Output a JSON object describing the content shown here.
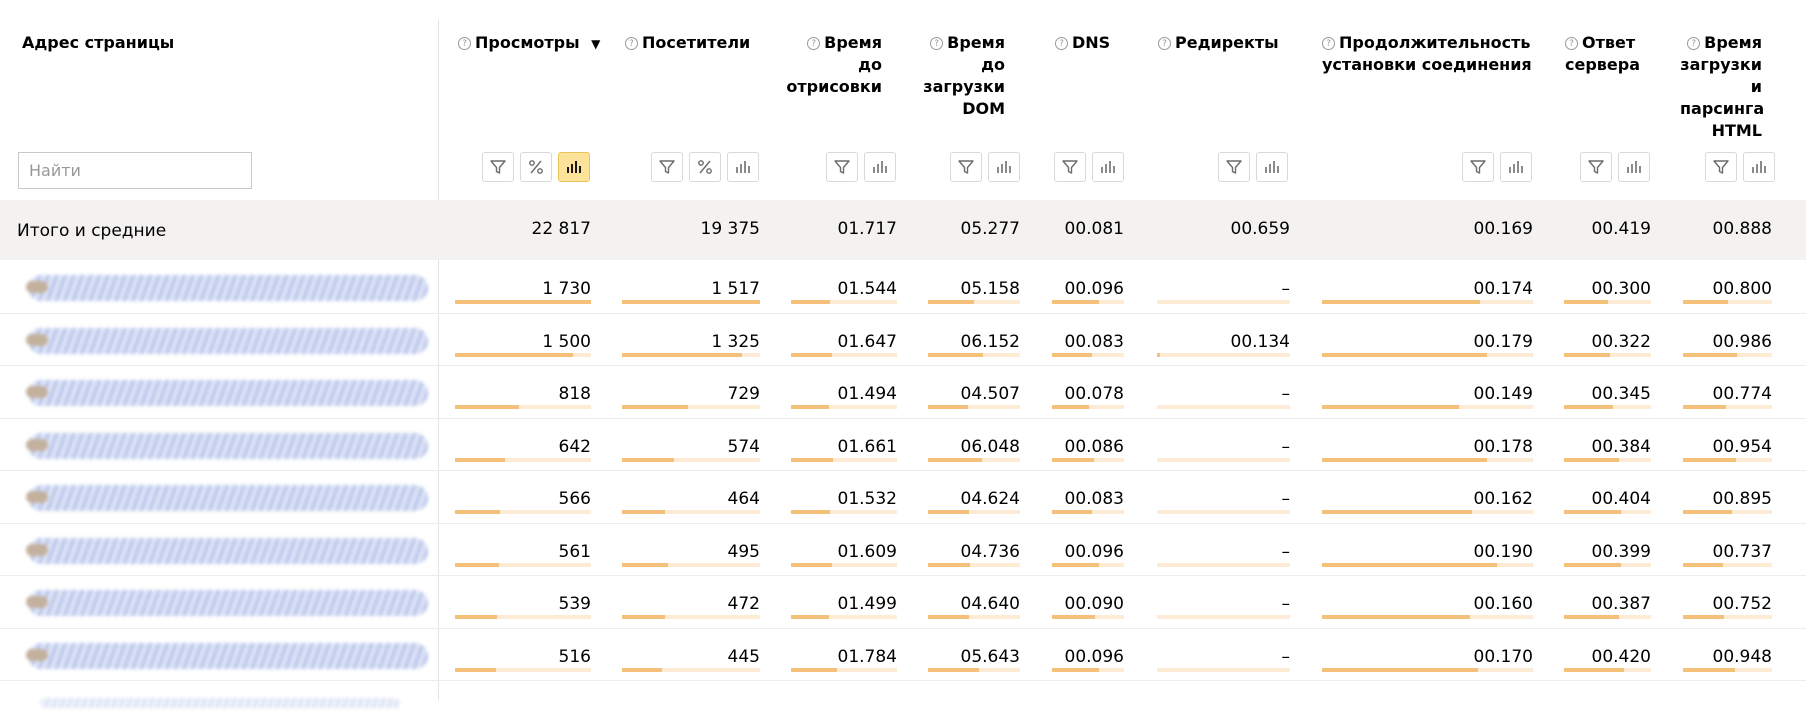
{
  "search": {
    "placeholder": "Найти"
  },
  "headers": {
    "url": "Адрес страницы",
    "views": "Просмотры",
    "sort_arrow": "▼",
    "visitors": "Посетители",
    "render": [
      "Время",
      "до",
      "отрисовки"
    ],
    "dom": [
      "Время",
      "до",
      "загрузки",
      "DOM"
    ],
    "dns": "DNS",
    "redirects": "Редиректы",
    "connect": [
      "Продолжительность",
      "установки соединения"
    ],
    "server": [
      "Ответ",
      "сервера"
    ],
    "html": [
      "Время",
      "загрузки",
      "и",
      "парсинга",
      "HTML"
    ],
    "help_glyph": "?",
    "percent_glyph": "%"
  },
  "totals": {
    "label": "Итого и средние",
    "views": "22 817",
    "visitors": "19 375",
    "render": "01.717",
    "dom": "05.277",
    "dns": "00.081",
    "redirects": "00.659",
    "connect": "00.169",
    "server": "00.419",
    "html": "00.888"
  },
  "rows": [
    {
      "views": "1 730",
      "visitors": "1 517",
      "render": "01.544",
      "dom": "05.158",
      "dns": "00.096",
      "redirects": "–",
      "connect": "00.174",
      "server": "00.300",
      "html": "00.800"
    },
    {
      "views": "1 500",
      "visitors": "1 325",
      "render": "01.647",
      "dom": "06.152",
      "dns": "00.083",
      "redirects": "00.134",
      "connect": "00.179",
      "server": "00.322",
      "html": "00.986"
    },
    {
      "views": "818",
      "visitors": "729",
      "render": "01.494",
      "dom": "04.507",
      "dns": "00.078",
      "redirects": "–",
      "connect": "00.149",
      "server": "00.345",
      "html": "00.774"
    },
    {
      "views": "642",
      "visitors": "574",
      "render": "01.661",
      "dom": "06.048",
      "dns": "00.086",
      "redirects": "–",
      "connect": "00.178",
      "server": "00.384",
      "html": "00.954"
    },
    {
      "views": "566",
      "visitors": "464",
      "render": "01.532",
      "dom": "04.624",
      "dns": "00.083",
      "redirects": "–",
      "connect": "00.162",
      "server": "00.404",
      "html": "00.895"
    },
    {
      "views": "561",
      "visitors": "495",
      "render": "01.609",
      "dom": "04.736",
      "dns": "00.096",
      "redirects": "–",
      "connect": "00.190",
      "server": "00.399",
      "html": "00.737"
    },
    {
      "views": "539",
      "visitors": "472",
      "render": "01.499",
      "dom": "04.640",
      "dns": "00.090",
      "redirects": "–",
      "connect": "00.160",
      "server": "00.387",
      "html": "00.752"
    },
    {
      "views": "516",
      "visitors": "445",
      "render": "01.784",
      "dom": "05.643",
      "dns": "00.096",
      "redirects": "–",
      "connect": "00.170",
      "server": "00.420",
      "html": "00.948"
    }
  ],
  "bar_fractions": [
    {
      "views": 1.0,
      "visitors": 1.0,
      "render": 0.37,
      "dom": 0.5,
      "dns": 0.65,
      "redirects": 0.0,
      "connect": 0.75,
      "server": 0.5,
      "html": 0.5
    },
    {
      "views": 0.87,
      "visitors": 0.87,
      "render": 0.39,
      "dom": 0.6,
      "dns": 0.56,
      "redirects": 0.02,
      "connect": 0.78,
      "server": 0.53,
      "html": 0.61
    },
    {
      "views": 0.47,
      "visitors": 0.48,
      "render": 0.36,
      "dom": 0.44,
      "dns": 0.52,
      "redirects": 0.0,
      "connect": 0.65,
      "server": 0.56,
      "html": 0.48
    },
    {
      "views": 0.37,
      "visitors": 0.38,
      "render": 0.4,
      "dom": 0.59,
      "dns": 0.58,
      "redirects": 0.0,
      "connect": 0.78,
      "server": 0.63,
      "html": 0.59
    },
    {
      "views": 0.33,
      "visitors": 0.31,
      "render": 0.37,
      "dom": 0.45,
      "dns": 0.56,
      "redirects": 0.0,
      "connect": 0.71,
      "server": 0.66,
      "html": 0.55
    },
    {
      "views": 0.32,
      "visitors": 0.33,
      "render": 0.39,
      "dom": 0.46,
      "dns": 0.65,
      "redirects": 0.0,
      "connect": 0.83,
      "server": 0.65,
      "html": 0.45
    },
    {
      "views": 0.31,
      "visitors": 0.31,
      "render": 0.36,
      "dom": 0.45,
      "dns": 0.6,
      "redirects": 0.0,
      "connect": 0.7,
      "server": 0.63,
      "html": 0.46
    },
    {
      "views": 0.3,
      "visitors": 0.29,
      "render": 0.43,
      "dom": 0.55,
      "dns": 0.65,
      "redirects": 0.0,
      "connect": 0.74,
      "server": 0.69,
      "html": 0.58
    }
  ],
  "colors": {
    "bar": "#f5c07a",
    "bar_track": "#fdebd5",
    "active_button": "#fde399",
    "total_row": "#f3f2f1"
  },
  "icons": {
    "filter": "filter-icon",
    "percent": "percent-icon",
    "chart": "bar-chart-icon",
    "help": "help-icon"
  }
}
